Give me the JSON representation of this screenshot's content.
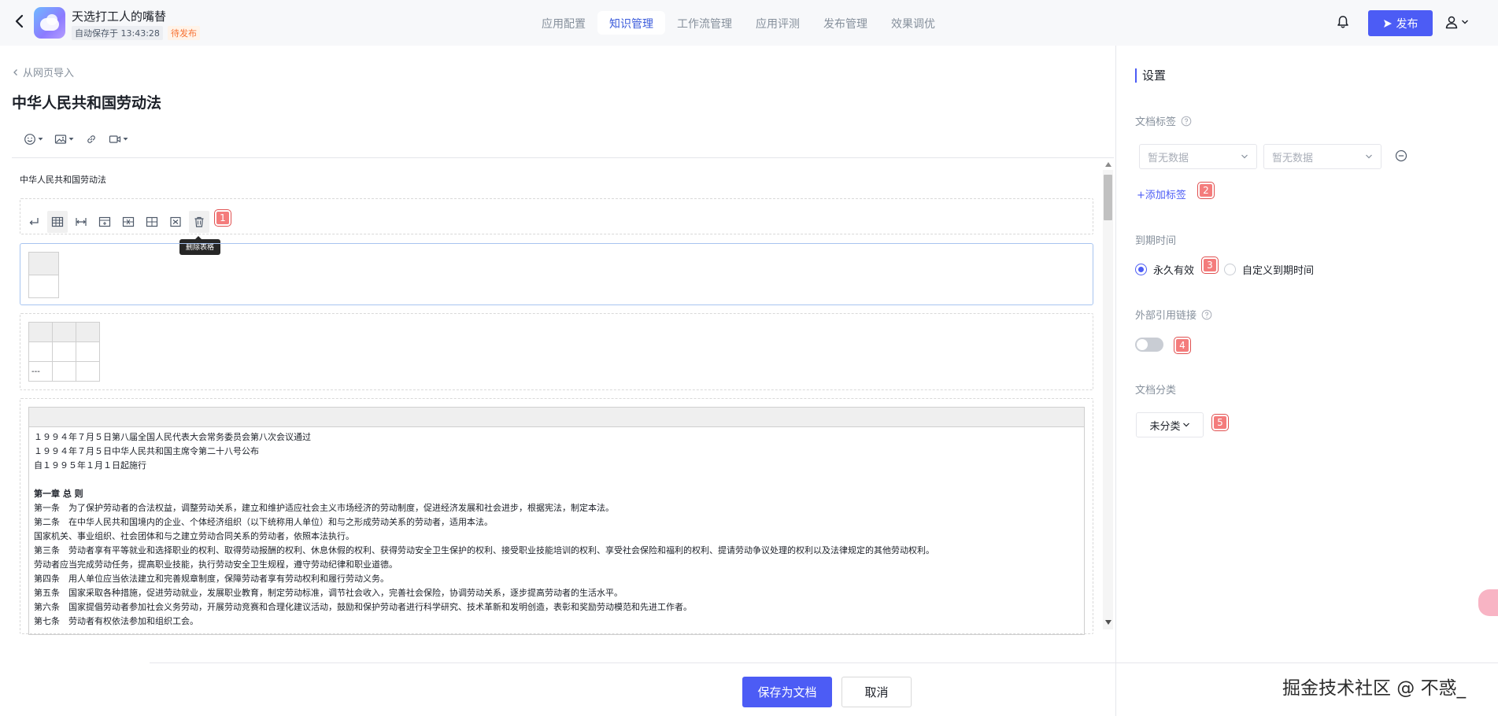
{
  "header": {
    "app_name": "天选打工人的嘴替",
    "autosave": "自动保存于 13:43:28",
    "status": "待发布",
    "tabs": [
      "应用配置",
      "知识管理",
      "工作流管理",
      "应用评测",
      "发布管理",
      "效果调优"
    ],
    "active_tab": "知识管理",
    "publish_label": "发布",
    "accent_color": "#4c5cf5"
  },
  "editor": {
    "breadcrumb": "从网页导入",
    "title": "中华人民共和国劳动法",
    "toolbar_icons": [
      "emoji-icon",
      "image-icon",
      "link-icon",
      "video-icon"
    ],
    "first_line": "中华人民共和国劳动法",
    "table_tooltip": "删除表格",
    "table_toolbar_icons": [
      "enter-icon",
      "table-icon",
      "column-width-icon",
      "insert-row-above-icon",
      "delete-row-icon",
      "insert-column-icon",
      "delete-cell-icon",
      "trash-icon"
    ],
    "ellipsis_cell": "---",
    "law_text": {
      "intro": [
        "１９９４年７月５日第八届全国人民代表大会常务委员会第八次会议通过",
        "１９９４年７月５日中华人民共和国主席令第二十八号公布",
        "自１９９５年１月１日起施行"
      ],
      "chapter": "第一章 总  则",
      "articles": [
        "第一条　为了保护劳动者的合法权益，调整劳动关系，建立和维护适应社会主义市场经济的劳动制度，促进经济发展和社会进步，根据宪法，制定本法。",
        "第二条　在中华人民共和国境内的企业、个体经济组织（以下统称用人单位）和与之形成劳动关系的劳动者，适用本法。",
        "国家机关、事业组织、社会团体和与之建立劳动合同关系的劳动者，依照本法执行。",
        "第三条　劳动者享有平等就业和选择职业的权利、取得劳动报酬的权利、休息休假的权利、获得劳动安全卫生保护的权利、接受职业技能培训的权利、享受社会保险和福利的权利、提请劳动争议处理的权利以及法律规定的其他劳动权利。",
        "劳动者应当完成劳动任务，提高职业技能，执行劳动安全卫生规程，遵守劳动纪律和职业道德。",
        "第四条　用人单位应当依法建立和完善规章制度，保障劳动者享有劳动权利和履行劳动义务。",
        "第五条　国家采取各种措施，促进劳动就业，发展职业教育，制定劳动标准，调节社会收入，完善社会保险，协调劳动关系，逐步提高劳动者的生活水平。",
        "第六条　国家提倡劳动者参加社会义务劳动，开展劳动竞赛和合理化建议活动，鼓励和保护劳动者进行科学研究、技术革新和发明创造，表彰和奖励劳动模范和先进工作者。",
        "第七条　劳动者有权依法参加和组织工会。"
      ]
    }
  },
  "markers": [
    "1",
    "2",
    "3",
    "4",
    "5"
  ],
  "settings": {
    "title": "设置",
    "doc_tag_label": "文档标签",
    "tag_select_1": "暂无数据",
    "tag_select_2": "暂无数据",
    "add_tag": "+添加标签",
    "expire_label": "到期时间",
    "expire_options": [
      "永久有效",
      "自定义到期时间"
    ],
    "expire_selected": "永久有效",
    "external_link_label": "外部引用链接",
    "external_link_enabled": false,
    "category_label": "文档分类",
    "category_value": "未分类"
  },
  "footer": {
    "save_label": "保存为文档",
    "cancel_label": "取消",
    "watermark": "掘金技术社区 @ 不惑_"
  }
}
